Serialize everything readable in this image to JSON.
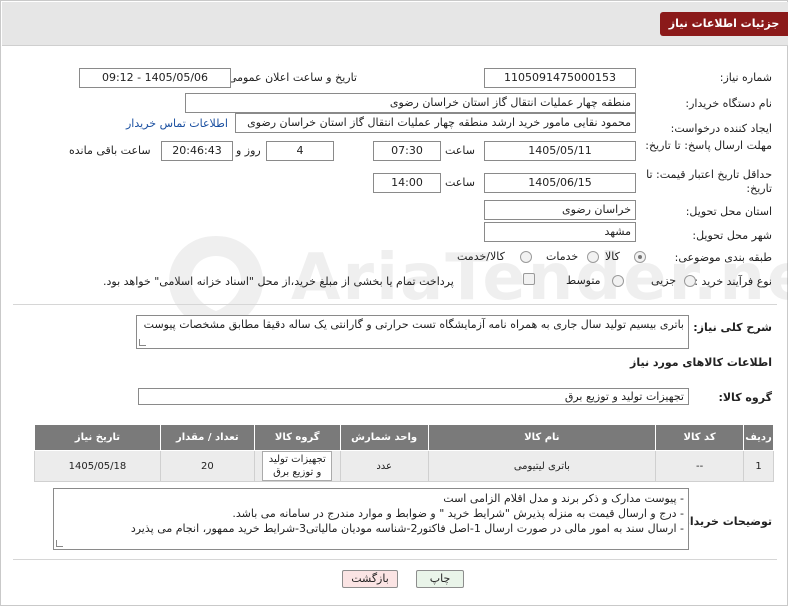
{
  "header": {
    "title": "جزئیات اطلاعات نیاز"
  },
  "form": {
    "need_number_label": "شماره نیاز:",
    "need_number": "1105091475000153",
    "announce_label": "تاریخ و ساعت اعلان عمومی:",
    "announce_value": "1405/05/06 - 09:12",
    "buyer_org_label": "نام دستگاه خریدار:",
    "buyer_org": "منطقه چهار عملیات انتقال گاز   استان خراسان رضوی",
    "requester_label": "ایجاد کننده درخواست:",
    "requester": "محمود نقایی مامور خرید ارشد منطقه چهار عملیات انتقال گاز   استان خراسان رضوی",
    "buyer_contact_link": "اطلاعات تماس خریدار",
    "reply_deadline_label": "مهلت ارسال پاسخ: تا تاریخ:",
    "reply_date": "1405/05/11",
    "time_label": "ساعت",
    "reply_time": "07:30",
    "days_count": "4",
    "days_and_label": "روز و",
    "remaining_time": "20:46:43",
    "remaining_label": "ساعت باقی مانده",
    "price_validity_label": "حداقل تاریخ اعتبار قیمت: تا تاریخ:",
    "validity_date": "1405/06/15",
    "validity_time": "14:00",
    "province_label": "استان محل تحویل:",
    "province": "خراسان رضوی",
    "city_label": "شهر محل تحویل:",
    "city": "مشهد",
    "category_label": "طبقه بندی موضوعی:",
    "category_options": [
      "کالا",
      "خدمات",
      "کالا/خدمت"
    ],
    "category_selected": "کالا",
    "process_label": "نوع فرآیند خرید :",
    "process_options": [
      "جزیی",
      "متوسط"
    ],
    "payment_note": "پرداخت تمام یا بخشی از مبلغ خرید،از محل \"اسناد خزانه اسلامی\" خواهد بود.",
    "description_label": "شرح کلی نیاز:",
    "description": "باتری بیسیم تولید سال جاری به همراه نامه آزمایشگاه تست حرارتی و گارانتی یک ساله دقیقا مطابق مشخصات پیوست"
  },
  "items_section": {
    "title": "اطلاعات کالاهای مورد نیاز",
    "group_label": "گروه کالا:",
    "group_value": "تجهیزات تولید و توزیع برق",
    "columns": [
      "ردیف",
      "کد کالا",
      "نام کالا",
      "واحد شمارش",
      "گروه کالا",
      "تعداد / مقدار",
      "تاریخ نیاز"
    ],
    "rows": [
      {
        "row": "1",
        "code": "--",
        "name": "باتری لیتیومی",
        "unit": "عدد",
        "group": "تجهیزات تولید و توزیع برق",
        "qty": "20",
        "date": "1405/05/18"
      }
    ]
  },
  "buyer_notes": {
    "label": "توضیحات خریدار:",
    "lines": [
      "- پیوست مدارک و ذکر برند و مدل اقلام الزامی است",
      "- درج و ارسال قیمت به منزله پذیرش \"شرایط خرید \" و ضوابط و موارد مندرج در سامانه می باشد.",
      "- ارسال سند به امور مالی در صورت ارسال 1-اصل فاکتور2-شناسه مودیان مالیاتی3-شرایط خرید ممهور، انجام می پذیرد"
    ]
  },
  "buttons": {
    "print": "چاپ",
    "back": "بازگشت"
  },
  "watermark": {
    "text": "AriaTender.neT"
  }
}
